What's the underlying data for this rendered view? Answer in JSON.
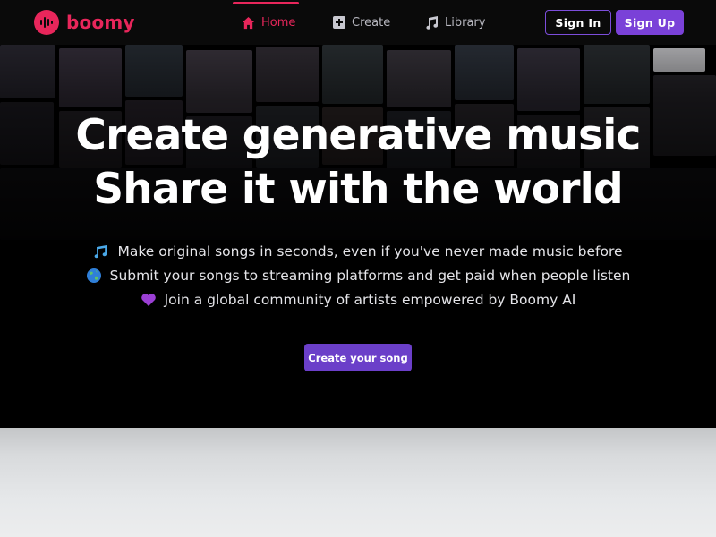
{
  "brand": {
    "name": "boomy",
    "icon": "boomy-logo-icon",
    "color": "#e8265b"
  },
  "nav": {
    "items": [
      {
        "label": "Home",
        "icon": "home-icon",
        "active": true
      },
      {
        "label": "Create",
        "icon": "plus-square-icon",
        "active": false
      },
      {
        "label": "Library",
        "icon": "music-note-icon",
        "active": false
      }
    ],
    "sign_in": "Sign In",
    "sign_up": "Sign Up"
  },
  "hero": {
    "headline_1": "Create generative music",
    "headline_2": "Share it with the world",
    "features": [
      {
        "icon": "music-notes-emoji",
        "text": "Make original songs in seconds, even if you've never made music before"
      },
      {
        "icon": "globe-emoji",
        "text": "Submit your songs to streaming platforms and get paid when people listen"
      },
      {
        "icon": "purple-heart-emoji",
        "text": "Join a global community of artists empowered by Boomy AI"
      }
    ],
    "cta": "Create your song"
  },
  "colors": {
    "accent": "#e8265b",
    "primary": "#7a41d8",
    "cta": "#6b3fc9"
  }
}
